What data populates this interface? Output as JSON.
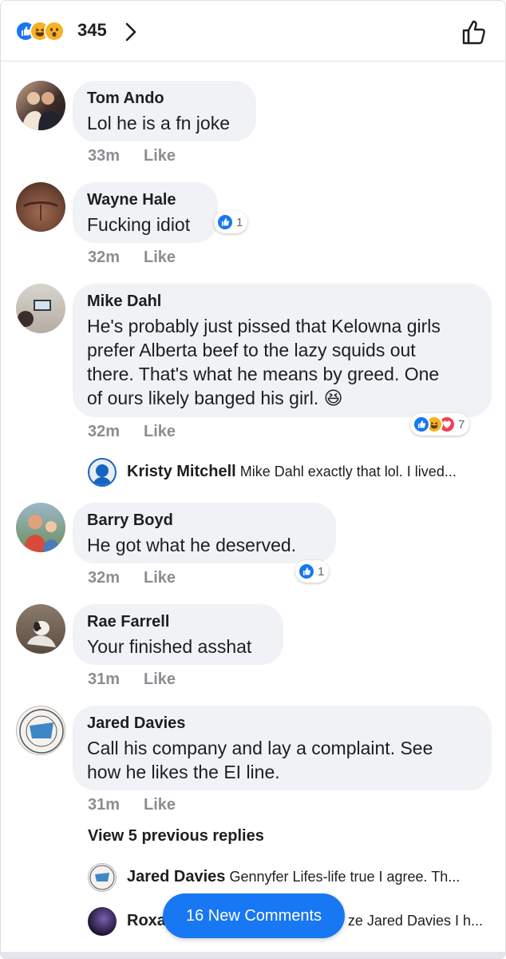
{
  "header": {
    "reaction_count": "345",
    "reactions": [
      "like-reaction-icon",
      "haha-reaction-icon",
      "wow-reaction-icon"
    ]
  },
  "colors": {
    "like_blue": "#1877f2",
    "haha_yellow": "#f7b125",
    "love_red": "#f33e58",
    "bubble_bg": "#f0f2f5",
    "meta_gray": "#8a8d91"
  },
  "comments": [
    {
      "author": "Tom Ando",
      "text": "Lol he is a fn joke",
      "time": "33m",
      "like_label": "Like"
    },
    {
      "author": "Wayne Hale",
      "text": "Fucking idiot",
      "time": "32m",
      "like_label": "Like",
      "reactions": "1"
    },
    {
      "author": "Mike Dahl",
      "text_lines": [
        "He's probably just pissed that Kelowna girls",
        "prefer Alberta beef to the lazy squids out",
        "there. That's what he means by greed. One",
        "of ours likely banged his girl."
      ],
      "time": "32m",
      "like_label": "Like",
      "reactions": "7"
    },
    {
      "author": "Barry Boyd",
      "text": "He got  what  he deserved.",
      "time": "32m",
      "like_label": "Like",
      "reactions": "1"
    },
    {
      "author": "Rae Farrell",
      "text": "Your finished asshat",
      "time": "31m",
      "like_label": "Like"
    },
    {
      "author": "Jared Davies",
      "text_lines": [
        "Call his company and lay a complaint. See",
        "how he likes the EI line."
      ],
      "time": "31m",
      "like_label": "Like"
    }
  ],
  "replies": {
    "kristy": {
      "name": "Kristy Mitchell",
      "text": "Mike Dahl exactly that lol. I lived..."
    },
    "jared": {
      "name": "Jared Davies",
      "text": "Gennyfer Lifes-life  true I agree. Th..."
    },
    "roxa": {
      "name": "Roxa",
      "text": "ze Jared Davies I h..."
    }
  },
  "view_previous": "View 5 previous replies",
  "new_comments_button": "16 New Comments",
  "emoji": "😆"
}
